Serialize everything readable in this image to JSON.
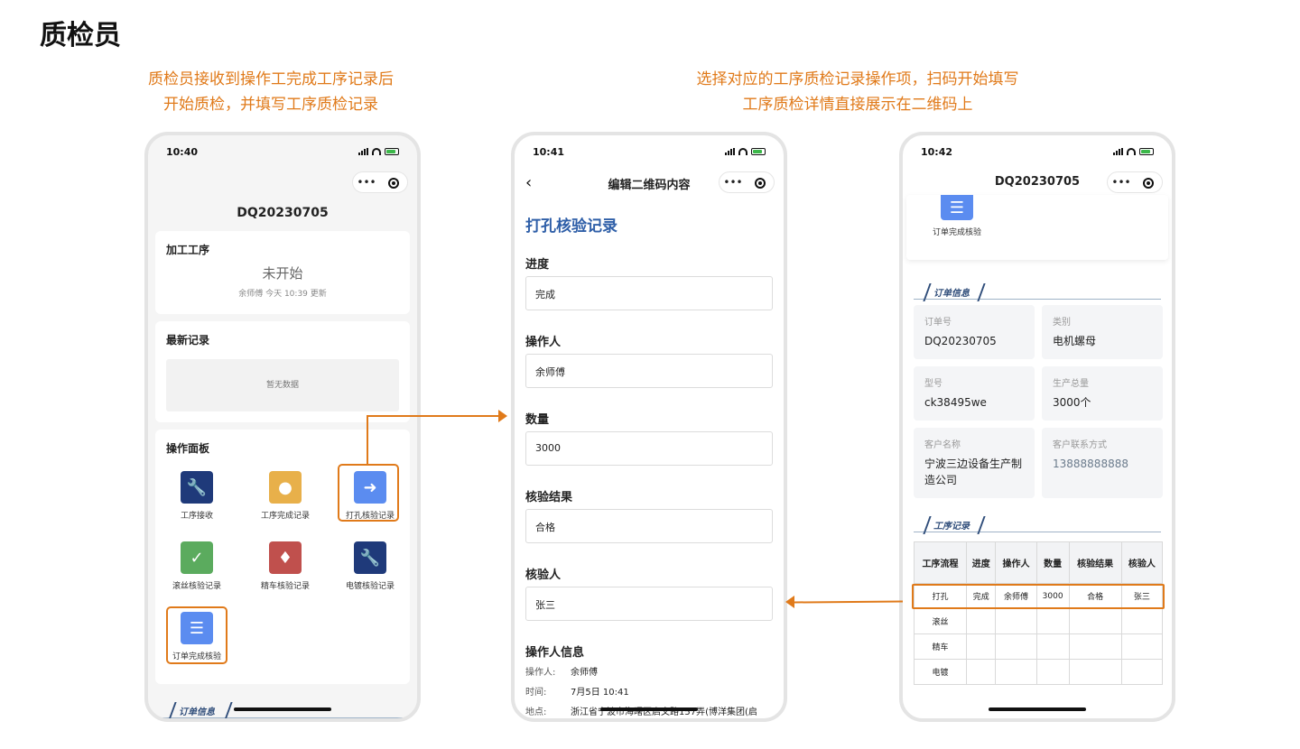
{
  "page_title": "质检员",
  "captions": {
    "left": [
      "质检员接收到操作工完成工序记录后",
      "开始质检，并填写工序质检记录"
    ],
    "right": [
      "选择对应的工序质检记录操作项，扫码开始填写",
      "工序质检详情直接展示在二维码上"
    ]
  },
  "phone1": {
    "time": "10:40",
    "capsule_more": "•••",
    "nav_title": "DQ20230705",
    "process_card": {
      "title": "加工工序",
      "status": "未开始",
      "meta": "余师傅 今天 10:39 更新"
    },
    "records_card": {
      "title": "最新记录",
      "empty": "暂无数据"
    },
    "panel": {
      "title": "操作面板",
      "items": [
        {
          "label": "工序接收",
          "icon": "wrench-icon",
          "color": "#1f3a7a"
        },
        {
          "label": "工序完成记录",
          "icon": "location-pin-icon",
          "color": "#e8b04a"
        },
        {
          "label": "打孔核验记录",
          "icon": "arrow-in-icon",
          "color": "#5b8cf0"
        },
        {
          "label": "滚丝核验记录",
          "icon": "shield-check-icon",
          "color": "#5bab5e"
        },
        {
          "label": "精车核验记录",
          "icon": "hydrant-icon",
          "color": "#c0504d"
        },
        {
          "label": "电镀核验记录",
          "icon": "wrench-icon",
          "color": "#1f3a7a"
        },
        {
          "label": "订单完成核验",
          "icon": "list-icon",
          "color": "#5b8cf0"
        }
      ]
    },
    "footer_section": "订单信息"
  },
  "phone2": {
    "time": "10:41",
    "capsule_more": "•••",
    "back_icon": "chevron-left-icon",
    "nav_title": "编辑二维码内容",
    "heading": "打孔核验记录",
    "fields": [
      {
        "label": "进度",
        "value": "完成"
      },
      {
        "label": "操作人",
        "value": "余师傅"
      },
      {
        "label": "数量",
        "value": "3000"
      },
      {
        "label": "核验结果",
        "value": "合格"
      },
      {
        "label": "核验人",
        "value": "张三"
      }
    ],
    "operator_info": {
      "title": "操作人信息",
      "rows": [
        {
          "k": "操作人:",
          "v": "余师傅"
        },
        {
          "k": "时间:",
          "v": "7月5日 10:41"
        },
        {
          "k": "地点:",
          "v": "浙江省宁波市海曙区启文路157弄(博洋集团(启"
        }
      ]
    }
  },
  "phone3": {
    "time": "10:42",
    "capsule_more": "•••",
    "nav_title": "DQ20230705",
    "top_item": {
      "label": "订单完成核验",
      "icon": "list-icon"
    },
    "order_section": "订单信息",
    "order_info": [
      {
        "k": "订单号",
        "v": "DQ20230705"
      },
      {
        "k": "类别",
        "v": "电机螺母"
      },
      {
        "k": "型号",
        "v": "ck38495we"
      },
      {
        "k": "生产总量",
        "v": "3000个"
      },
      {
        "k": "客户名称",
        "v": "宁波三边设备生产制造公司"
      },
      {
        "k": "客户联系方式",
        "v": "13888888888"
      }
    ],
    "process_section": "工序记录",
    "table": {
      "headers": [
        "工序流程",
        "进度",
        "操作人",
        "数量",
        "核验结果",
        "核验人"
      ],
      "rows": [
        [
          "打孔",
          "完成",
          "余师傅",
          "3000",
          "合格",
          "张三"
        ],
        [
          "滚丝",
          "",
          "",
          "",
          "",
          ""
        ],
        [
          "精车",
          "",
          "",
          "",
          "",
          ""
        ],
        [
          "电镀",
          "",
          "",
          "",
          "",
          ""
        ]
      ]
    }
  },
  "colors": {
    "accent": "#e07a1a",
    "heading_blue": "#2f5fa8"
  }
}
